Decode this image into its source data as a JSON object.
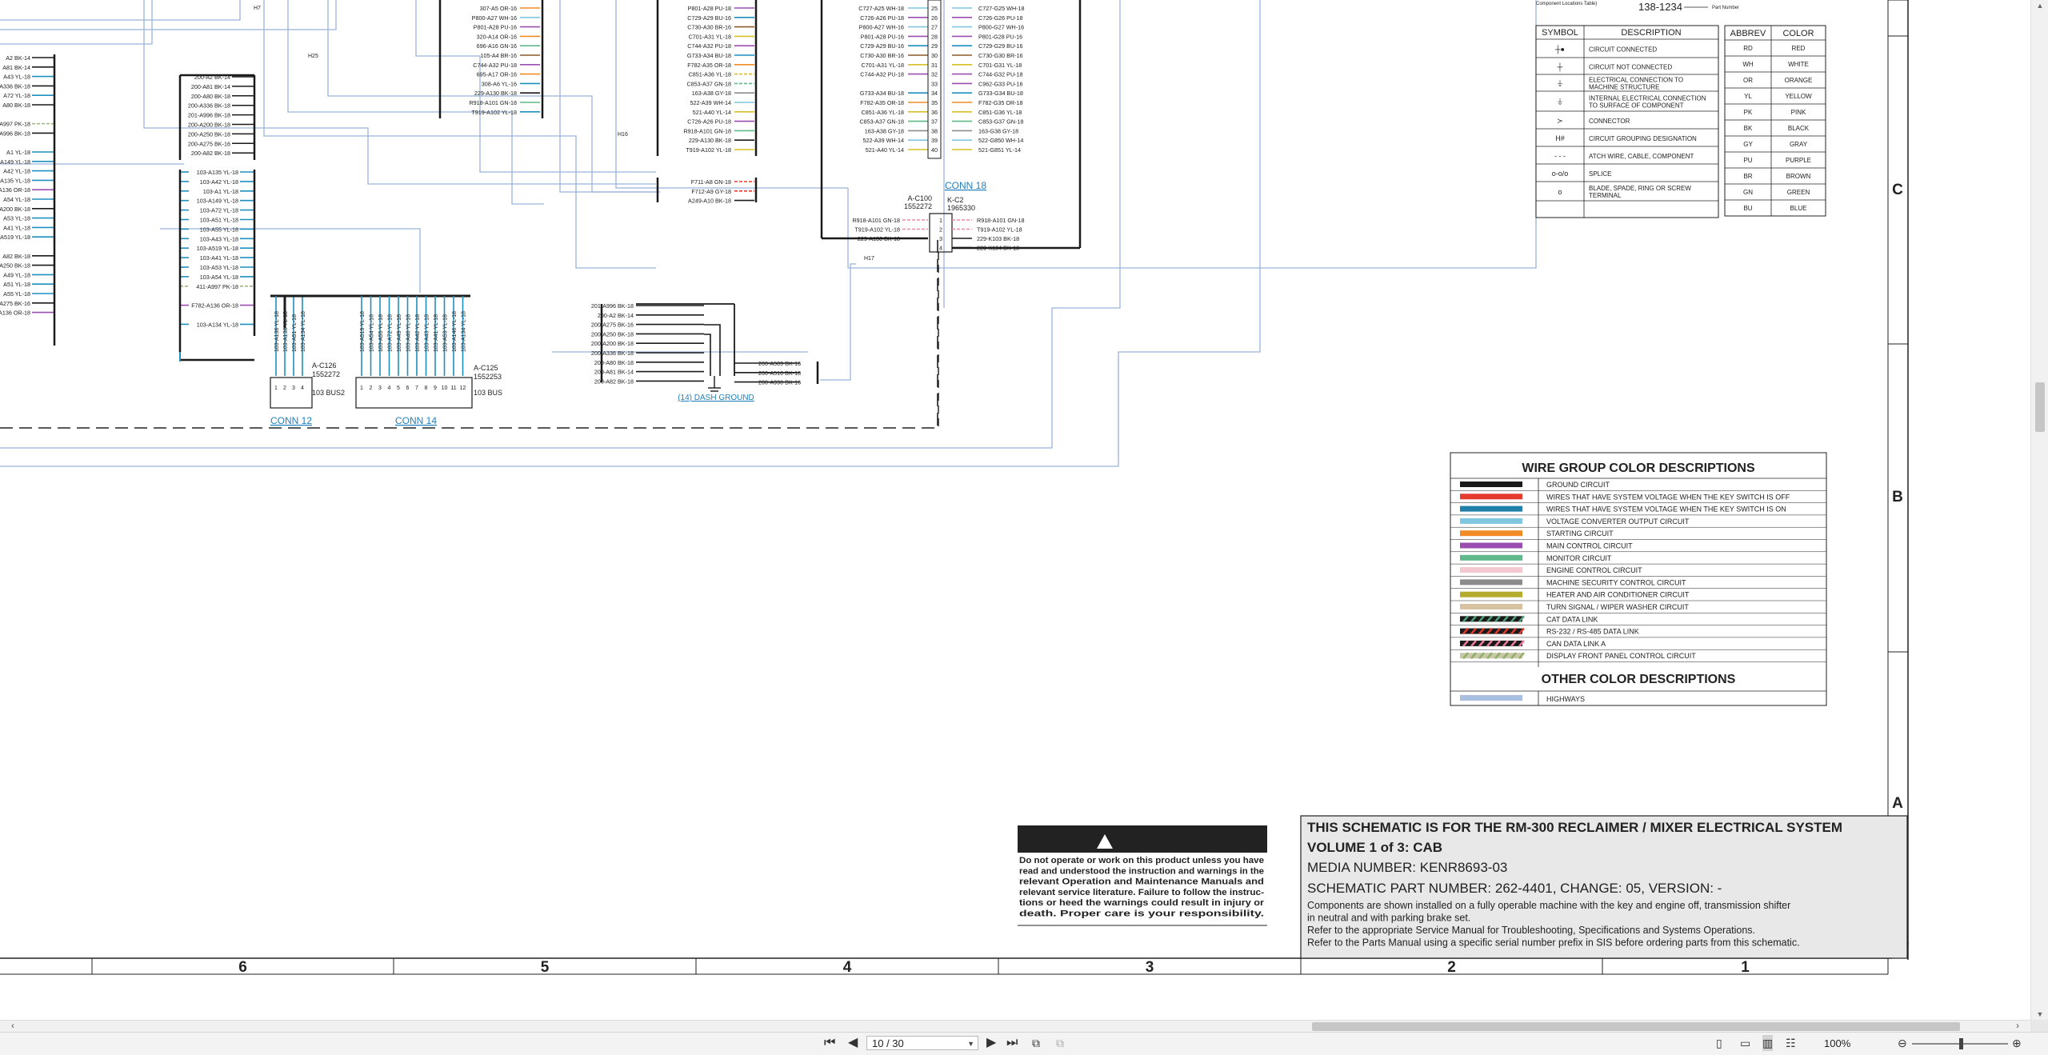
{
  "sheet": {
    "grid_columns": [
      "6",
      "5",
      "4",
      "3",
      "2",
      "1"
    ],
    "grid_rows": [
      "C",
      "B",
      "A"
    ],
    "connectors": [
      {
        "name": "CONN 12",
        "id": "A-C126",
        "part": "1552272",
        "bus": "103 BUS2",
        "pins": [
          "1",
          "2",
          "3",
          "4"
        ],
        "wires": [
          "103-A136 YL-18",
          "103-A138 YL-18",
          "103-A51 YL-18",
          "103-A134 YL-18"
        ]
      },
      {
        "name": "CONN 14",
        "id": "A-C125",
        "part": "1552253",
        "bus": "103 BUS",
        "pins": [
          "1",
          "2",
          "3",
          "4",
          "5",
          "6",
          "7",
          "8",
          "9",
          "10",
          "11",
          "12"
        ],
        "wires": [
          "103-A519 YL-18",
          "103-A54 YL-18",
          "103-A55 YL-18",
          "103-A72 YL-18",
          "103-A49 YL-18",
          "103-A40 YL-18",
          "103-A42 YL-18",
          "103-A43 YL-18",
          "103-A41 YL-18",
          "103-A53 YL-18",
          "103-A146 YL-18",
          "103-A134 YL-18"
        ]
      },
      {
        "name": "CONN 18",
        "id": "A-C100",
        "part": "1552272",
        "conn_id": "K-C2",
        "conn_part": "1965330",
        "pins": [
          "1",
          "2",
          "3",
          "4"
        ],
        "left_wires": [
          "R918-A101 GN-18",
          "T919-A102 YL-18",
          "229-A130 BK-18",
          ""
        ],
        "right_wires": [
          "R918-A101 GN-18",
          "T919-A102 YL-18",
          "229-K103 BK-18",
          "229-K104 BK-18"
        ]
      }
    ],
    "dash_ground_label": "(14) DASH GROUND",
    "dash_ground_wires": [
      "201-A996 BK-18",
      "200-A2 BK-14",
      "200-A275 BK-16",
      "200-A250 BK-18",
      "200-A200 BK-18",
      "200-A336 BK-18",
      "200-A80 BK-18",
      "200-A81 BK-14",
      "200-A82 BK-18"
    ],
    "dash_ground_right": [
      "200-A509 BK-16",
      "200-A510 BK-18",
      "200-A990 BK-16"
    ],
    "ground_bus_wires": [
      "200-A2 BK-14",
      "200-A81 BK-14",
      "200-A80 BK-18",
      "200-A336 BK-18",
      "201-A996 BK-18",
      "200-A200 BK-18",
      "200-A250 BK-18",
      "200-A275 BK-16",
      "200-A82 BK-18"
    ],
    "yl_bus_wires": [
      "103-A135 YL-18",
      "103-A42 YL-18",
      "103-A1 YL-18",
      "103-A149 YL-18",
      "103-A72 YL-18",
      "103-A51 YL-18",
      "103-A55 YL-18",
      "103-A43 YL-18",
      "103-A519 YL-18",
      "103-A41 YL-18",
      "103-A53 YL-18",
      "103-A54 YL-18",
      "411-A997 PK-18",
      "",
      "F782-A136 OR-18",
      "",
      "103-A134 YL-18"
    ],
    "left_edge_wires": [
      "A2 BK-14",
      "A81 BK-14",
      "A43 YL-18",
      "A336 BK-18",
      "A72 YL-18",
      "A80 BK-18",
      "",
      "A997 PK-18",
      "A996 BK-18",
      "",
      "A1 YL-18",
      "A149 YL-18",
      "A42 YL-18",
      "A135 YL-18",
      "A136 OR-18",
      "A54 YL-18",
      "A200 BK-18",
      "A53 YL-18",
      "A41 YL-18",
      "A519 YL-18",
      "",
      "A82 BK-18",
      "A250 BK-18",
      "A49 YL-18",
      "A51 YL-18",
      "A55 YL-18",
      "A275 BK-16",
      "A136 OR-18"
    ],
    "top_block_a": [
      "307-A5 OR-16",
      "P800-A27 WH-16",
      "P801-A28 PU-16",
      "320-A14 OR-16",
      "696-A16 GN-16",
      "105-A4 BR-16",
      "C744-A32 PU-18",
      "695-A17 OR-16",
      "308-A6 YL-16",
      "229-A130 BK-18",
      "R918-A101 GN-18",
      "T919-A102 YL-18"
    ],
    "top_block_b": [
      "P801-A28 PU-18",
      "C729-A29 BU-16",
      "C730-A30 BR-16",
      "C701-A31 YL-18",
      "C744-A32 PU-18",
      "G733-A34 BU-18",
      "F782-A35 OR-18",
      "C851-A36 YL-18",
      "C853-A37 GN-18",
      "163-A38 GY-18",
      "522-A39 WH-14",
      "521-A40 YL-14",
      "C726-A26 PU-18",
      "R918-A101 GN-18",
      "229-A130 BK-18",
      "T919-A102 YL-18"
    ],
    "top_block_b2": [
      "F711-A8 GN-18",
      "F712-A9 GY-18",
      "A249-A10 BK-18"
    ],
    "k_conn_pins": [
      "25",
      "26",
      "27",
      "28",
      "29",
      "30",
      "31",
      "32",
      "33",
      "34",
      "35",
      "36",
      "37",
      "38",
      "39",
      "40"
    ],
    "k_conn_left": [
      "C727-A25 WH-18",
      "C726-A26 PU-18",
      "P800-A27 WH-16",
      "P801-A28 PU-16",
      "C729-A29 BU-16",
      "C730-A30 BR-16",
      "C701-A31 YL-18",
      "C744-A32 PU-18",
      "",
      "G733-A34 BU-18",
      "F782-A35 OR-18",
      "C851-A36 YL-18",
      "C853-A37 GN-18",
      "163-A38 GY-18",
      "522-A39 WH-14",
      "521-A40 YL-14"
    ],
    "k_conn_right": [
      "C727-G25 WH-18",
      "C726-G26 PU-18",
      "P800-G27 WH-16",
      "P801-G28 PU-16",
      "C729-G29 BU-16",
      "C730-G30 BR-16",
      "C701-G31 YL-18",
      "C744-G32 PU-18",
      "C962-G33 PU-16",
      "G733-G34 BU-18",
      "F782-G35 OR-18",
      "C851-G36 YL-18",
      "C853-G37 GN-18",
      "163-G38 GY-18",
      "522-G850 WH-14",
      "521-G851 YL-14"
    ],
    "h_markers": [
      "H7",
      "H25",
      "H16",
      "H17"
    ],
    "part_number_callout": {
      "caption": "Component Locations Table)",
      "value": "138-1234",
      "note": "Part Number"
    },
    "symbol_table": {
      "headers": [
        "SYMBOL",
        "DESCRIPTION"
      ],
      "rows": [
        {
          "symbol": "┼●",
          "description": "CIRCUIT CONNECTED"
        },
        {
          "symbol": "┼",
          "description": "CIRCUIT NOT CONNECTED"
        },
        {
          "symbol": "⏚",
          "description": "ELECTRICAL CONNECTION TO MACHINE STRUCTURE"
        },
        {
          "symbol": "⏚",
          "description": "INTERNAL ELECTRICAL CONNECTION TO SURFACE OF COMPONENT"
        },
        {
          "symbol": "≻",
          "description": "CONNECTOR"
        },
        {
          "symbol": "H#",
          "description": "CIRCUIT GROUPING DESIGNATION"
        },
        {
          "symbol": "- - -",
          "description": "ATCH WIRE, CABLE, COMPONENT"
        },
        {
          "symbol": "o-o/o",
          "description": "SPLICE"
        },
        {
          "symbol": "o",
          "description": "BLADE, SPADE, RING OR SCREW TERMINAL"
        }
      ]
    },
    "abbrev_table": {
      "headers": [
        "ABBREV",
        "COLOR"
      ],
      "rows": [
        [
          "RD",
          "RED"
        ],
        [
          "WH",
          "WHITE"
        ],
        [
          "OR",
          "ORANGE"
        ],
        [
          "YL",
          "YELLOW"
        ],
        [
          "PK",
          "PINK"
        ],
        [
          "BK",
          "BLACK"
        ],
        [
          "GY",
          "GRAY"
        ],
        [
          "PU",
          "PURPLE"
        ],
        [
          "BR",
          "BROWN"
        ],
        [
          "GN",
          "GREEN"
        ],
        [
          "BU",
          "BLUE"
        ]
      ]
    },
    "wire_group": {
      "title": "WIRE GROUP COLOR DESCRIPTIONS",
      "rows": [
        {
          "label": "GROUND CIRCUIT",
          "color": "#1a1a1a",
          "color2": ""
        },
        {
          "label": "WIRES THAT HAVE SYSTEM VOLTAGE WHEN THE KEY SWITCH IS OFF",
          "color": "#e53b2e",
          "color2": ""
        },
        {
          "label": "WIRES THAT HAVE SYSTEM VOLTAGE WHEN THE KEY SWITCH IS ON",
          "color": "#1f7fa8",
          "color2": ""
        },
        {
          "label": "VOLTAGE CONVERTER OUTPUT CIRCUIT",
          "color": "#7fc6e0",
          "color2": ""
        },
        {
          "label": "STARTING CIRCUIT",
          "color": "#f18b25",
          "color2": ""
        },
        {
          "label": "MAIN CONTROL CIRCUIT",
          "color": "#9a4fb0",
          "color2": ""
        },
        {
          "label": "MONITOR CIRCUIT",
          "color": "#5fb98a",
          "color2": ""
        },
        {
          "label": "ENGINE CONTROL CIRCUIT",
          "color": "#f4c8d0",
          "color2": ""
        },
        {
          "label": "MACHINE SECURITY CONTROL CIRCUIT",
          "color": "#8c8c8c",
          "color2": ""
        },
        {
          "label": "HEATER AND AIR CONDITIONER CIRCUIT",
          "color": "#b5ab2c",
          "color2": ""
        },
        {
          "label": "TURN SIGNAL / WIPER WASHER CIRCUIT",
          "color": "#d9c2a0",
          "color2": ""
        },
        {
          "label": "CAT DATA LINK",
          "color": "#1a1a1a",
          "color2": "#4fa37a"
        },
        {
          "label": "RS-232 / RS-485 DATA LINK",
          "color": "#1a1a1a",
          "color2": "#e53b2e"
        },
        {
          "label": "CAN DATA LINK A",
          "color": "#1a1a1a",
          "color2": "#f07ca0"
        },
        {
          "label": "DISPLAY FRONT PANEL CONTROL CIRCUIT",
          "color": "#c8c8a8",
          "color2": "#8fae6a"
        }
      ],
      "other_title": "OTHER COLOR DESCRIPTIONS",
      "other_rows": [
        {
          "label": "HIGHWAYS",
          "color": "#a8bfe0"
        }
      ]
    },
    "warning": {
      "title": "WARNING",
      "lines": [
        "Do not operate or work on this product unless you have",
        "read and understood the instruction and warnings in the",
        "relevant Operation and Maintenance Manuals and",
        "relevant service literature. Failure to follow the instruc-",
        "tions or heed the warnings could result in injury or",
        "death. Proper care is your responsibility."
      ]
    },
    "title_block": {
      "line1": "THIS SCHEMATIC IS FOR THE RM-300 RECLAIMER / MIXER ELECTRICAL SYSTEM",
      "line2": "VOLUME 1 of 3: CAB",
      "media": "MEDIA NUMBER: KENR8693-03",
      "part": "SCHEMATIC PART NUMBER: 262-4401, CHANGE: 05, VERSION: -",
      "notes": [
        "Components are shown installed on a fully operable machine with the key and engine off, transmission shifter",
        "in neutral and with parking brake set.",
        "Refer to the appropriate Service Manual for Troubleshooting, Specifications and Systems Operations.",
        "Refer to the Parts Manual using a specific serial number prefix in SIS before ordering parts from this schematic."
      ]
    }
  },
  "toolbar": {
    "page_value": "10 / 30",
    "zoom_value": "100%",
    "first_icon": "first-page-icon",
    "prev_icon": "previous-page-icon",
    "next_icon": "next-page-icon",
    "last_icon": "last-page-icon"
  },
  "colors": {
    "highway": "#9ab3db",
    "link": "#1f7fbf",
    "yellow_wire": "#d6c12a",
    "blue_wire": "#1f8fc0"
  }
}
